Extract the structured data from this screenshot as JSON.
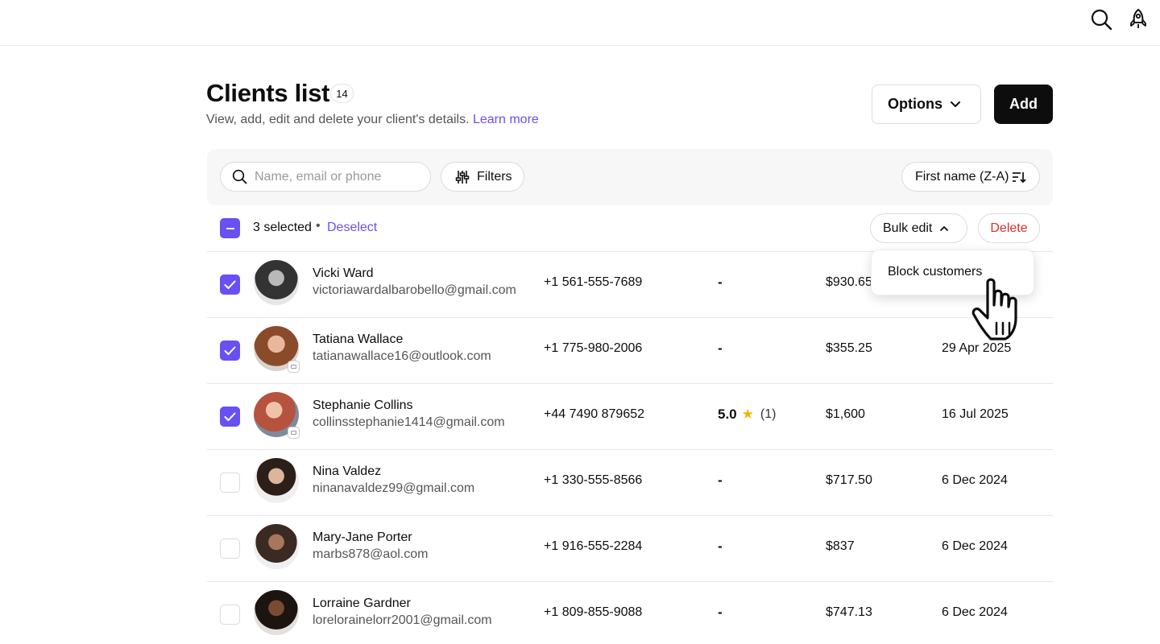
{
  "header": {
    "title": "Clients list",
    "count": "14",
    "subtitle": "View, add, edit and delete your client's details.",
    "learn_more": "Learn more",
    "options_label": "Options",
    "add_label": "Add"
  },
  "filters": {
    "search_placeholder": "Name, email or phone",
    "filters_label": "Filters",
    "sort_label": "First name (Z-A)"
  },
  "selection": {
    "count_text": "3 selected",
    "separator": "•",
    "deselect_label": "Deselect",
    "bulk_edit_label": "Bulk edit",
    "delete_label": "Delete"
  },
  "dropdown": {
    "items": [
      "Block customers"
    ]
  },
  "clients": [
    {
      "name": "Vicki Ward",
      "email": "victoriawardalbarobello@gmail.com",
      "phone": "+1 561-555-7689",
      "rating": "-",
      "spend": "$930.65",
      "date": "",
      "selected": true
    },
    {
      "name": "Tatiana Wallace",
      "email": "tatianawallace16@outlook.com",
      "phone": "+1 775-980-2006",
      "rating": "-",
      "spend": "$355.25",
      "date": "29 Apr 2025",
      "selected": true
    },
    {
      "name": "Stephanie Collins",
      "email": "collinsstephanie1414@gmail.com",
      "phone": "+44 7490 879652",
      "rating": "5.0",
      "rating_count": "(1)",
      "spend": "$1,600",
      "date": "16 Jul 2025",
      "selected": true
    },
    {
      "name": "Nina Valdez",
      "email": "ninanavaldez99@gmail.com",
      "phone": "+1 330-555-8566",
      "rating": "-",
      "spend": "$717.50",
      "date": "6 Dec 2024",
      "selected": false
    },
    {
      "name": "Mary-Jane Porter",
      "email": "marbs878@aol.com",
      "phone": "+1 916-555-2284",
      "rating": "-",
      "spend": "$837",
      "date": "6 Dec 2024",
      "selected": false
    },
    {
      "name": "Lorraine Gardner",
      "email": "lorelorainelorr2001@gmail.com",
      "phone": "+1 809-855-9088",
      "rating": "-",
      "spend": "$747.13",
      "date": "6 Dec 2024",
      "selected": false
    }
  ],
  "colors": {
    "accent": "#6950f3",
    "danger": "#e02d2d",
    "primary_button": "#0d0d0d",
    "star": "#f5b400"
  },
  "icons": {
    "top_right": [
      "search-icon",
      "rocket-icon"
    ]
  }
}
